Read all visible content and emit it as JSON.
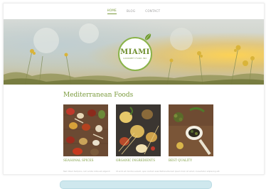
{
  "nav": {
    "items": [
      {
        "label": "Home"
      },
      {
        "label": "Blog"
      },
      {
        "label": "Contact"
      }
    ]
  },
  "logo": {
    "title": "MIAMI",
    "subtitle": "Gourmet Food Inc"
  },
  "section": {
    "title": "Mediterranean Foods"
  },
  "cards": [
    {
      "title": "SEASONAL SPICES",
      "text": "Nam libero tempore, cum soluta nobis est eligendi"
    },
    {
      "title": "ORGANIC INGREDIENTS",
      "text": "Ut enim ad minima veniam, quis nostrum exercitationem"
    },
    {
      "title": "BEST QUALITY",
      "text": "Lorem ipsum dolor sit amet, consectetur adipiscing elit"
    }
  ],
  "colors": {
    "accent": "#7a9a3c",
    "logo_ring": "#8ab34a",
    "pill": "#cfe8ee"
  }
}
